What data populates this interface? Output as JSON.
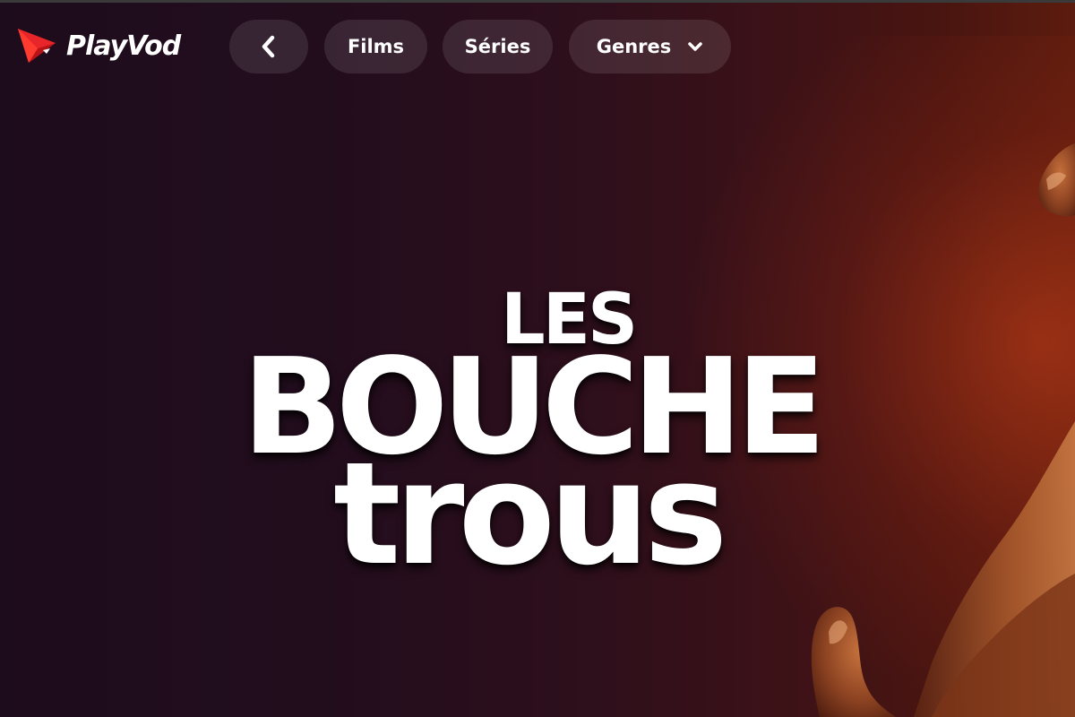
{
  "app": {
    "name": "PlayVod",
    "logo_icon": "play-triangle-logo-icon",
    "brand_color": "#e8262a"
  },
  "nav": {
    "back_icon": "chevron-left-icon",
    "films_label": "Films",
    "series_label": "Séries",
    "genres_label": "Genres",
    "genres_icon": "chevron-down-icon"
  },
  "hero": {
    "title_line1": "Les",
    "title_line2": "Bouche",
    "title_line3": "trous",
    "background_colors": [
      "#1d0c1c",
      "#3e1216",
      "#5c1c0e"
    ]
  }
}
